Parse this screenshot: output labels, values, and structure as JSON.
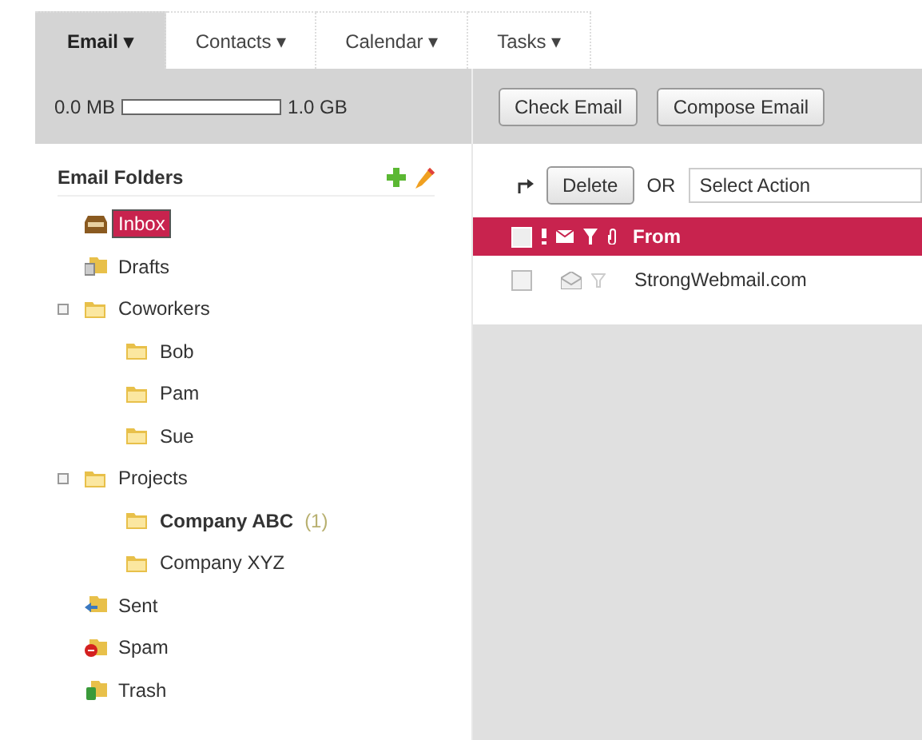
{
  "tabs": [
    {
      "label": "Email ▾",
      "selected": true
    },
    {
      "label": "Contacts ▾",
      "selected": false
    },
    {
      "label": "Calendar ▾",
      "selected": false
    },
    {
      "label": "Tasks ▾",
      "selected": false
    }
  ],
  "storage": {
    "used": "0.0 MB",
    "total": "1.0 GB",
    "level": 0
  },
  "toolbar_buttons": [
    "Check Email",
    "Compose Email"
  ],
  "folders": {
    "title": "Email Folders",
    "items": [
      {
        "name": "Inbox",
        "kind": "inbox",
        "selected": true,
        "bold": false
      },
      {
        "name": "Drafts",
        "kind": "drafts",
        "selected": false,
        "bold": false
      },
      {
        "name": "Coworkers",
        "kind": "folder",
        "selected": false,
        "bold": false,
        "expanded": true,
        "children": [
          {
            "name": "Bob",
            "kind": "folder",
            "selected": false,
            "bold": false
          },
          {
            "name": "Pam",
            "kind": "folder",
            "selected": false,
            "bold": false
          },
          {
            "name": "Sue",
            "kind": "folder",
            "selected": false,
            "bold": false
          }
        ]
      },
      {
        "name": "Projects",
        "kind": "folder",
        "selected": false,
        "bold": false,
        "expanded": true,
        "children": [
          {
            "name": "Company ABC",
            "kind": "folder",
            "selected": false,
            "bold": true,
            "count": "(1)"
          },
          {
            "name": "Company XYZ",
            "kind": "folder",
            "selected": false,
            "bold": false
          }
        ]
      },
      {
        "name": "Sent",
        "kind": "sent",
        "selected": false,
        "bold": false
      },
      {
        "name": "Spam",
        "kind": "spam",
        "selected": false,
        "bold": false
      },
      {
        "name": "Trash",
        "kind": "trash",
        "selected": false,
        "bold": false
      }
    ]
  },
  "actions": {
    "delete": "Delete",
    "or": "OR",
    "select": "Select Action"
  },
  "message_list": {
    "header": "From",
    "select_all_checked": false,
    "rows": [
      {
        "from": "StrongWebmail.com",
        "checked": false
      }
    ]
  }
}
